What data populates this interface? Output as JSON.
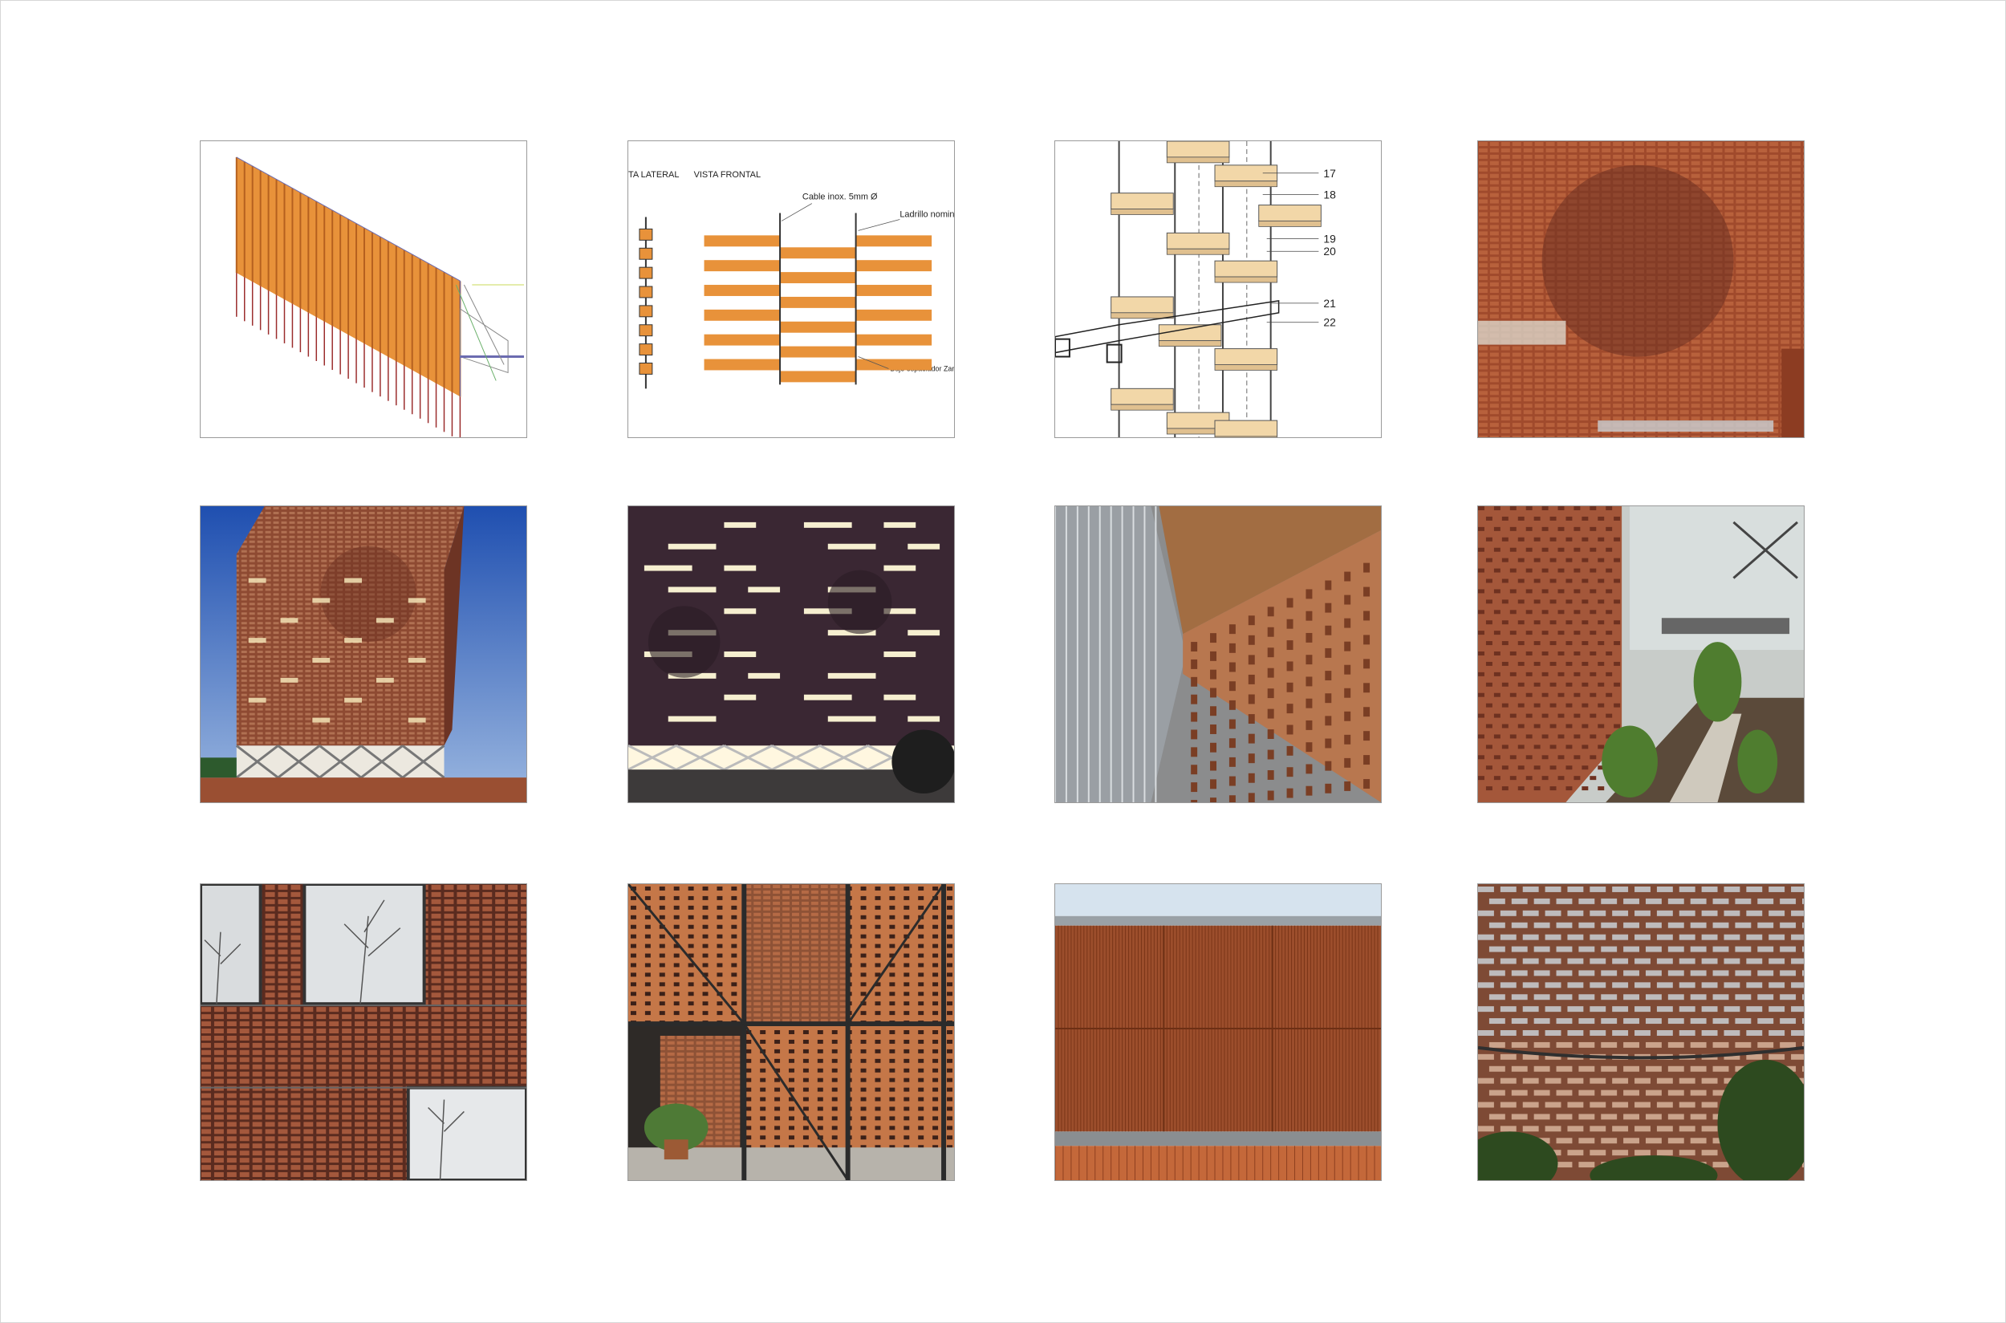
{
  "panels": {
    "lateral_frontal": {
      "lateral_label": "TA LATERAL",
      "frontal_label": "VISTA FRONTAL",
      "cable_label": "Cable inox. 5mm Ø",
      "brick_label": "Ladrillo nomin",
      "bushing_label": "Buje espaciador Zar"
    },
    "exploded": {
      "numbers": [
        "17",
        "18",
        "19",
        "20",
        "21",
        "22"
      ]
    }
  },
  "colors": {
    "brick": "#e8923a",
    "brick_light": "#f2d7a8",
    "terracotta": "#a34f2e",
    "sky": "#2f5fb8",
    "tile_border": "#9a9a9a"
  }
}
